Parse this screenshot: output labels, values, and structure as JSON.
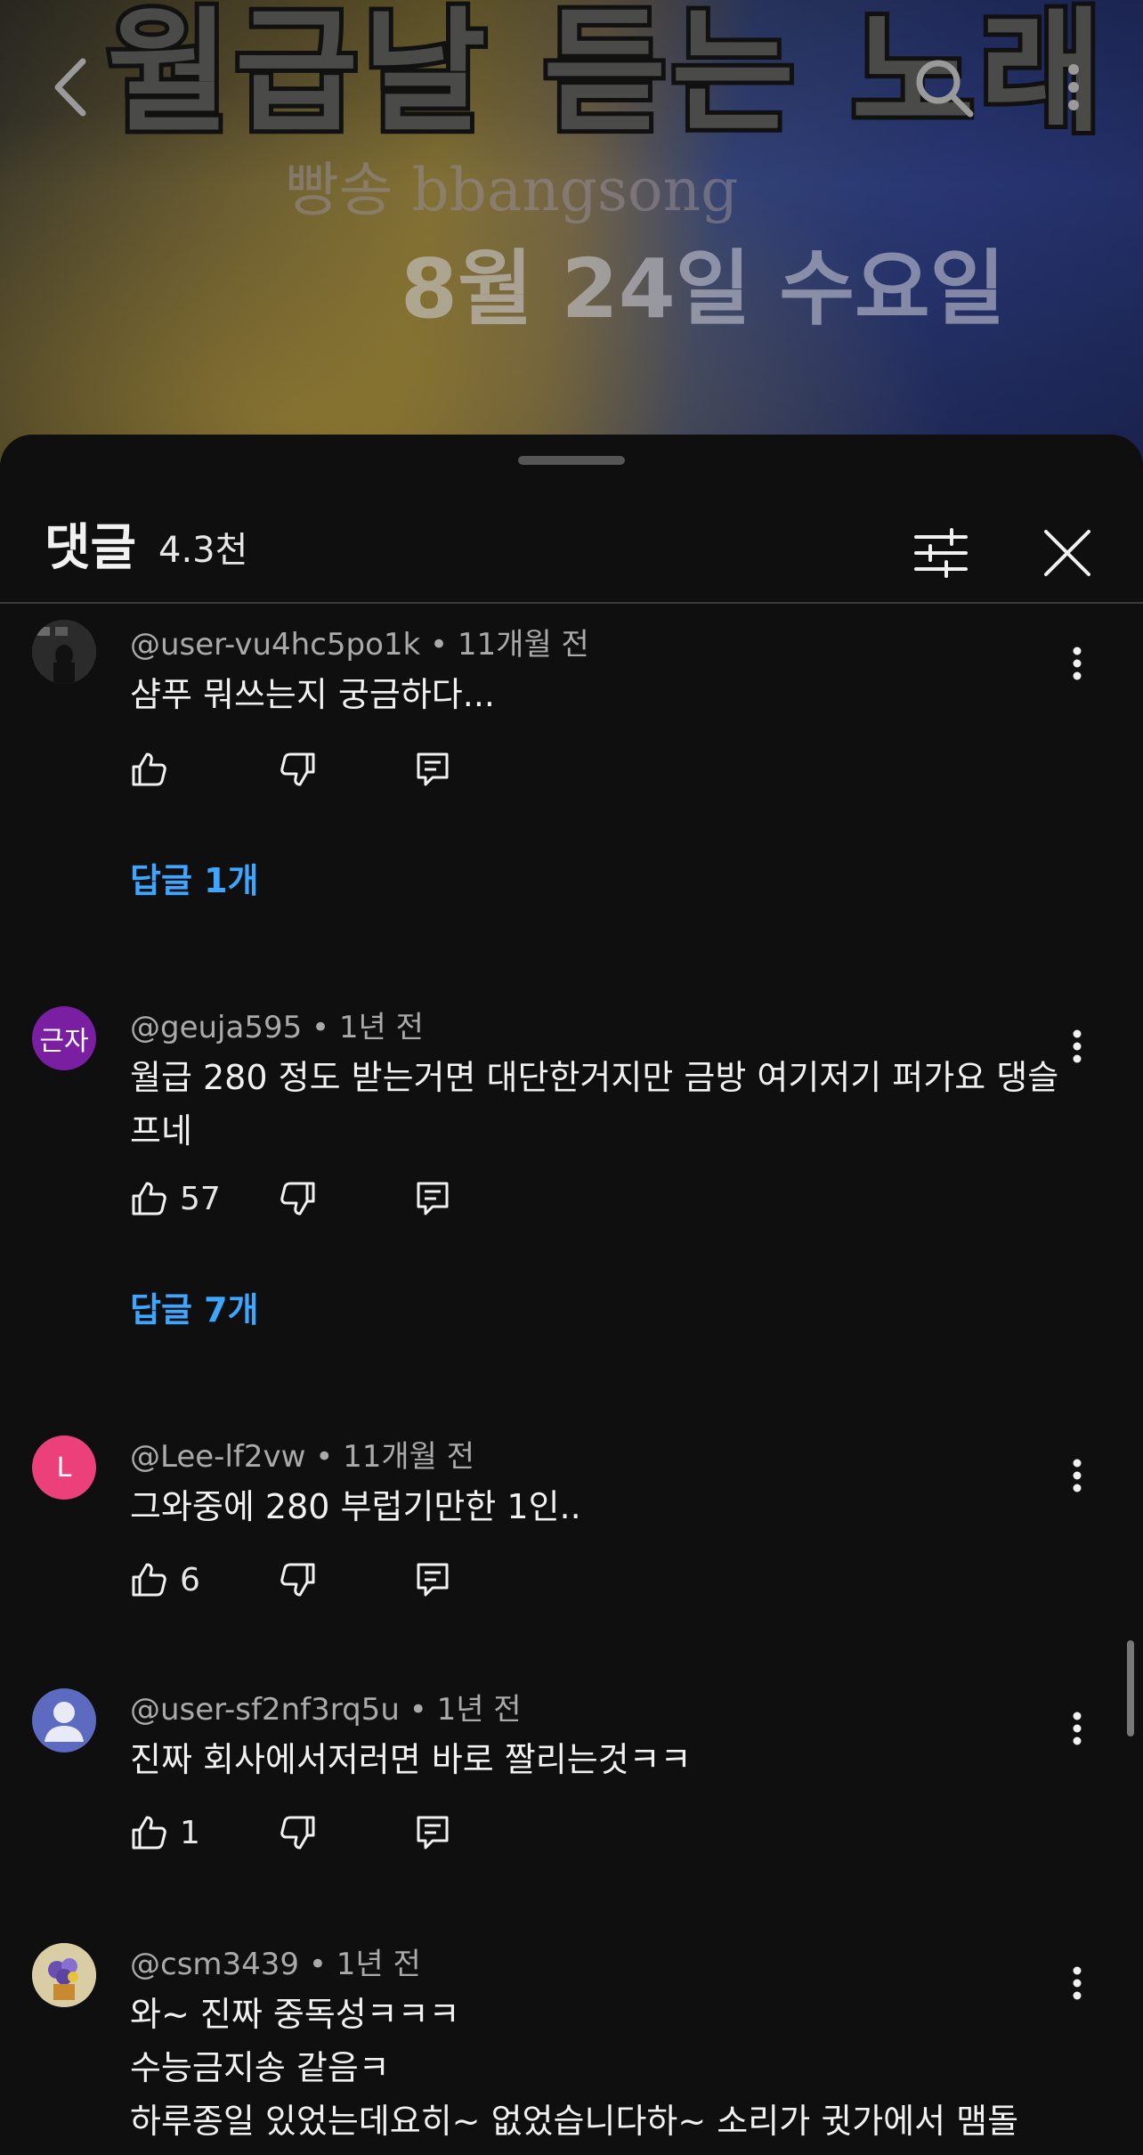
{
  "video": {
    "title_overlay": "월급날 듣는 노래",
    "channel_overlay": "빵송 bbangsong",
    "date_overlay": "8월 24일 수요일"
  },
  "sheet": {
    "title": "댓글",
    "count": "4.3천"
  },
  "icons": {
    "back": "chevron-left-icon",
    "search": "search-icon",
    "more": "more-vert-icon",
    "filter": "sliders-icon",
    "close": "close-icon",
    "like": "thumbs-up-icon",
    "dislike": "thumbs-down-icon",
    "reply": "reply-comment-icon"
  },
  "comments": [
    {
      "author": "@user-vu4hc5po1k",
      "time": "11개월 전",
      "text": "샴푸 뭐쓰는지 궁금하다...",
      "likes": "",
      "replies": "답글 1개",
      "avatar_text": "",
      "avatar_color": "#4a4a4a"
    },
    {
      "author": "@geuja595",
      "time": "1년 전",
      "text": "월급 280 정도 받는거면 대단한거지만 금방 여기저기 퍼가요 댕슬프네",
      "likes": "57",
      "replies": "답글 7개",
      "avatar_text": "근자",
      "avatar_color": "#7b1fa2"
    },
    {
      "author": "@Lee-lf2vw",
      "time": "11개월 전",
      "text": "그와중에 280 부럽기만한 1인..",
      "likes": "6",
      "replies": "",
      "avatar_text": "L",
      "avatar_color": "#ec407a"
    },
    {
      "author": "@user-sf2nf3rq5u",
      "time": "1년 전",
      "text": "진짜 회사에서저러면 바로 짤리는것ㅋㅋ",
      "likes": "1",
      "replies": "",
      "avatar_text": "",
      "avatar_color": "#5c6bc0"
    },
    {
      "author": "@csm3439",
      "time": "1년 전",
      "lines": [
        "와~ 진짜 중독성ㅋㅋㅋ",
        "수능금지송 같음ㅋ",
        "하루종일 있었는데요히~ 없었습니다하~ 소리가 귓가에서 맴돌"
      ],
      "avatar_text": "",
      "avatar_color": "#c8b27a"
    }
  ]
}
